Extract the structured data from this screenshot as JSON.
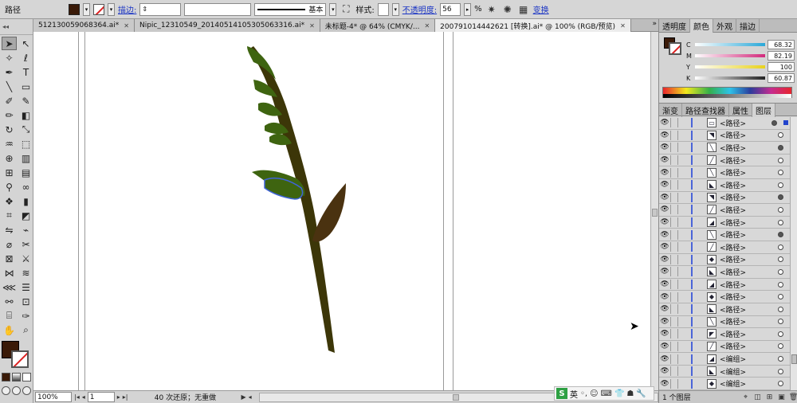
{
  "control_bar": {
    "object_type": "路径",
    "stroke_label": "描边:",
    "stroke_style": "基本",
    "style_label": "样式:",
    "opacity_label": "不透明度:",
    "opacity_value": "56",
    "opacity_unit": "%",
    "transform_link": "变换",
    "fill_color": "#3a1a08"
  },
  "doc_tabs": [
    {
      "label": "512130059068364.ai*",
      "active": false
    },
    {
      "label": "Nipic_12310549_20140514105305063316.ai*",
      "active": false
    },
    {
      "label": "未标题-4* @ 64% (CMYK/...",
      "active": false
    },
    {
      "label": "200791014442621 [转换].ai* @ 100% (RGB/预览)",
      "active": true
    }
  ],
  "doc_tabs_more": "»",
  "color_panel": {
    "tabs": [
      "透明度",
      "颜色",
      "外观",
      "描边"
    ],
    "active_tab": "颜色",
    "channels": [
      {
        "key": "C",
        "value": "68.32",
        "color": "#2aa8d8"
      },
      {
        "key": "M",
        "value": "82.19",
        "color": "#d22a7c"
      },
      {
        "key": "Y",
        "value": "100",
        "color": "#e8d21c"
      },
      {
        "key": "K",
        "value": "60.87",
        "color": "#222222"
      }
    ]
  },
  "layers_panel": {
    "tabs": [
      "渐变",
      "路径查找器",
      "属性",
      "图层"
    ],
    "active_tab": "图层",
    "rows": [
      {
        "name": "<路径>",
        "thumb": "▭",
        "targeted": true,
        "selected": true
      },
      {
        "name": "<路径>",
        "thumb": "◥",
        "targeted": false,
        "selected": false
      },
      {
        "name": "<路径>",
        "thumb": "╲",
        "targeted": true,
        "selected": false
      },
      {
        "name": "<路径>",
        "thumb": "╱",
        "targeted": false,
        "selected": false
      },
      {
        "name": "<路径>",
        "thumb": "╲",
        "targeted": false,
        "selected": false
      },
      {
        "name": "<路径>",
        "thumb": "◣",
        "targeted": false,
        "selected": false
      },
      {
        "name": "<路径>",
        "thumb": "◥",
        "targeted": true,
        "selected": false
      },
      {
        "name": "<路径>",
        "thumb": "╱",
        "targeted": false,
        "selected": false
      },
      {
        "name": "<路径>",
        "thumb": "◢",
        "targeted": false,
        "selected": false
      },
      {
        "name": "<路径>",
        "thumb": "╲",
        "targeted": true,
        "selected": false
      },
      {
        "name": "<路径>",
        "thumb": "╱",
        "targeted": false,
        "selected": false
      },
      {
        "name": "<路径>",
        "thumb": "◆",
        "targeted": false,
        "selected": false
      },
      {
        "name": "<路径>",
        "thumb": "◣",
        "targeted": false,
        "selected": false
      },
      {
        "name": "<路径>",
        "thumb": "◢",
        "targeted": false,
        "selected": false
      },
      {
        "name": "<路径>",
        "thumb": "◆",
        "targeted": false,
        "selected": false
      },
      {
        "name": "<路径>",
        "thumb": "◣",
        "targeted": false,
        "selected": false
      },
      {
        "name": "<路径>",
        "thumb": "╲",
        "targeted": false,
        "selected": false
      },
      {
        "name": "<路径>",
        "thumb": "◤",
        "targeted": false,
        "selected": false
      },
      {
        "name": "<路径>",
        "thumb": "╱",
        "targeted": false,
        "selected": false
      },
      {
        "name": "<编组>",
        "thumb": "◢",
        "targeted": false,
        "selected": false
      },
      {
        "name": "<编组>",
        "thumb": "◣",
        "targeted": false,
        "selected": false
      },
      {
        "name": "<编组>",
        "thumb": "◆",
        "targeted": false,
        "selected": false
      }
    ],
    "footer_text": "1 个图层"
  },
  "status_bar": {
    "zoom": "100%",
    "page": "1",
    "message": "40 次还原；无重做"
  },
  "ime": {
    "logo": "S",
    "mode": "英"
  },
  "colors": {
    "stem": "#3c3608",
    "leaf_green": "#3e6410",
    "leaf_brown": "#4a3210",
    "selection": "#3f64d8"
  }
}
